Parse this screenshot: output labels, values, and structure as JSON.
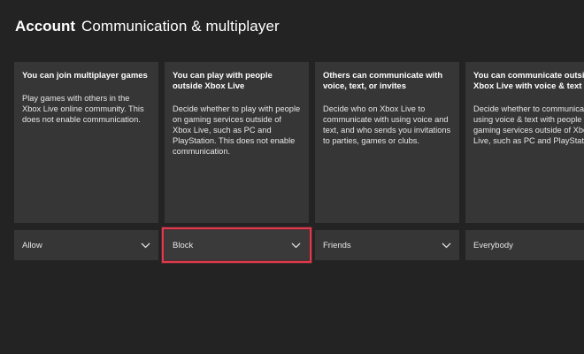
{
  "header": {
    "section": "Account",
    "page": "Communication & multiplayer"
  },
  "settings": [
    {
      "title": "You can join multiplayer games",
      "description": "Play games with others in the Xbox Live online community. This does not enable communication.",
      "value": "Allow"
    },
    {
      "title": "You can play with people outside Xbox Live",
      "description": "Decide whether to play with people on gaming services outside of Xbox Live, such as PC and PlayStation. This does not enable communication.",
      "value": "Block"
    },
    {
      "title": "Others can communicate with voice, text, or invites",
      "description": "Decide who on Xbox Live to communicate with using voice and text, and who sends you invitations to parties, games or clubs.",
      "value": "Friends"
    },
    {
      "title": "You can communicate outside Xbox Live with voice & text",
      "description": "Decide whether to communicate using voice & text with people on gaming services outside of Xbox Live, such as PC and PlayStation.",
      "value": "Everybody"
    }
  ],
  "focus_color": "#e03a4e",
  "icons": {
    "dropdown": "chevron-down-icon"
  }
}
